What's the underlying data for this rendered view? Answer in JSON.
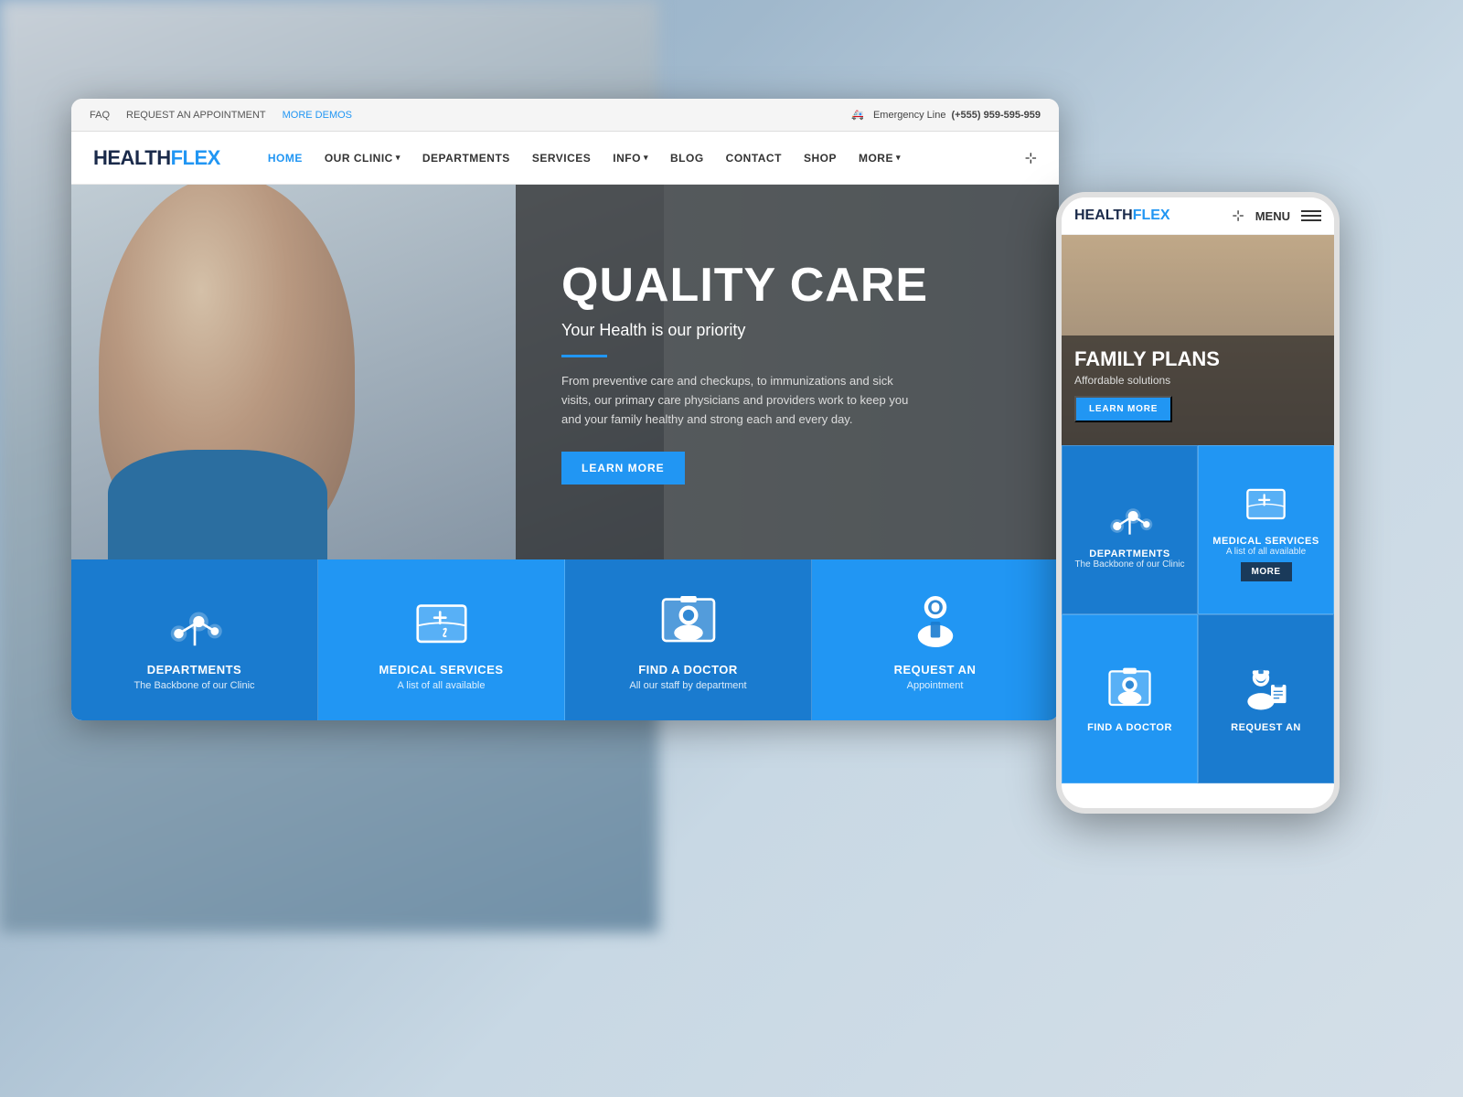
{
  "background": {
    "color": "#b0c4d8"
  },
  "topbar": {
    "links": [
      {
        "label": "FAQ",
        "active": false
      },
      {
        "label": "REQUEST AN APPOINTMENT",
        "active": false
      },
      {
        "label": "MORE DEMOS",
        "active": true
      }
    ],
    "emergency_label": "Emergency Line",
    "emergency_number": "(+555) 959-595-959"
  },
  "navbar": {
    "logo_health": "HEALTH",
    "logo_flex": "FLEX",
    "links": [
      {
        "label": "HOME",
        "active": true,
        "has_arrow": false
      },
      {
        "label": "OUR CLINIC",
        "active": false,
        "has_arrow": true
      },
      {
        "label": "DEPARTMENTS",
        "active": false,
        "has_arrow": false
      },
      {
        "label": "SERVICES",
        "active": false,
        "has_arrow": false
      },
      {
        "label": "INFO",
        "active": false,
        "has_arrow": true
      },
      {
        "label": "BLOG",
        "active": false,
        "has_arrow": false
      },
      {
        "label": "CONTACT",
        "active": false,
        "has_arrow": false
      },
      {
        "label": "SHOP",
        "active": false,
        "has_arrow": false
      },
      {
        "label": "MORE",
        "active": false,
        "has_arrow": true
      }
    ]
  },
  "hero": {
    "title": "QUALITY CA",
    "title_suffix": "RE",
    "subtitle": "Your Health is our priority",
    "description": "From preventive care and checkups, to immuni... primary care physicians and providers work to k... family healthy and strong each and every day.",
    "learn_more_btn": "LEARN MORE"
  },
  "services": [
    {
      "title": "DEPARTMENTS",
      "subtitle": "The Backbone of our Clinic",
      "icon": "departments"
    },
    {
      "title": "MEDICAL SERVICES",
      "subtitle": "A list of all available",
      "icon": "medical"
    },
    {
      "title": "FIND A DOCTOR",
      "subtitle": "All our staff by department",
      "icon": "doctor"
    },
    {
      "title": "REQUEST AN",
      "subtitle": "Appointment",
      "icon": "appointment"
    }
  ],
  "mobile": {
    "logo_health": "HEALTH",
    "logo_flex": "FLEX",
    "menu_label": "MENU",
    "hero": {
      "title": "FAMILY PLANS",
      "subtitle": "Affordable solutions",
      "btn_label": "LEARN MORE"
    },
    "grid": [
      {
        "title": "DEPARTMENTS",
        "subtitle": "The Backbone of our Clinic",
        "icon": "departments",
        "has_more": false
      },
      {
        "title": "MEDICAL SERVICES",
        "subtitle": "A list of all available",
        "icon": "medical",
        "has_more": true,
        "more_label": "MORE"
      },
      {
        "title": "FIND A DOCTOR",
        "subtitle": "",
        "icon": "doctor",
        "has_more": false
      },
      {
        "title": "REQUEST AN",
        "subtitle": "",
        "icon": "appointment",
        "has_more": false
      }
    ]
  }
}
